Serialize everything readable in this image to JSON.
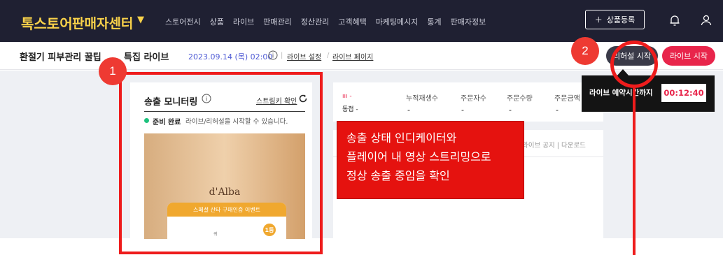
{
  "header": {
    "logo_brand": "톡스토어",
    "logo_rest": "판매자센터",
    "nav": [
      "스토어전시",
      "상품",
      "라이브",
      "판매관리",
      "정산관리",
      "고객혜택",
      "마케팅메시지",
      "통계",
      "판매자정보"
    ],
    "add_product_label": "상품등록"
  },
  "live_bar": {
    "title": "환절기 피부관리 꿀팁",
    "title_suffix": "특집 라이브",
    "datetime": "2023.09.14 (목) 02:00",
    "settings_link": "라이브 설정",
    "page_link": "라이브 페이지",
    "rehearsal_button": "리허설 시작",
    "live_start_button": "라이브 시작"
  },
  "monitor": {
    "title": "송출 모니터링",
    "stream_key_link": "스트림키 확인",
    "status_strong": "준비 완료",
    "status_text": "라이브/리허설을 시작할 수 있습니다.",
    "video": {
      "brand": "d'Alba",
      "event_title": "스페셜 산타 구매인증 이벤트",
      "event_badge": "1등",
      "event_small": "퀴"
    }
  },
  "stats": {
    "mini_label_1": "ııı -",
    "mini_label_2": "동접 -",
    "items": [
      {
        "label": "누적재생수",
        "value": "-"
      },
      {
        "label": "주문자수",
        "value": "-"
      },
      {
        "label": "주문수량",
        "value": "-"
      },
      {
        "label": "주문금액",
        "value": "-"
      }
    ]
  },
  "chat_panel": {
    "tabs": "라이브 공지 | 다운로드"
  },
  "tooltip": {
    "text": "라이브 예약시간까지",
    "countdown": "00:12:40"
  },
  "annotations": {
    "marker_1": "1",
    "marker_2": "2",
    "note_lines": [
      "송출 상태 인디케이터와",
      "플레이어 내 영상 스트리밍으로",
      "정상 송출 중임을 확인"
    ]
  },
  "colors": {
    "topbar": "#1f2032",
    "logo": "#f9d24a",
    "accent_red": "#e8254b",
    "annotation_red": "#ee1c1c",
    "ready_green": "#1ec27e"
  }
}
